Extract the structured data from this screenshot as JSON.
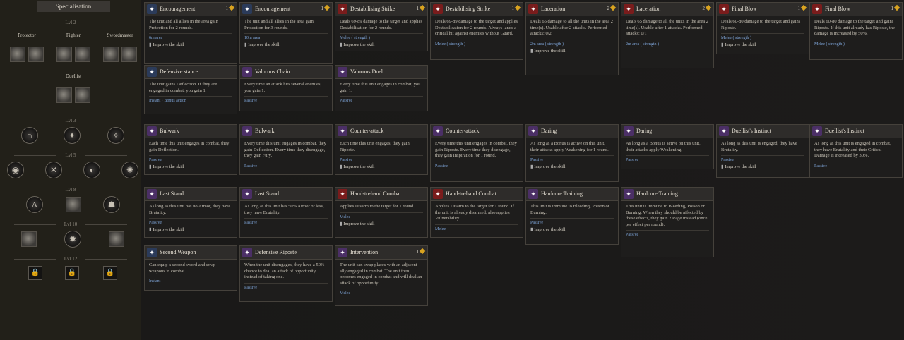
{
  "sidebar": {
    "title": "Specialisation",
    "classes": [
      "Protector",
      "Fighter",
      "Swordmaster",
      "Duellist"
    ],
    "levels": [
      "Lvl 2",
      "Lvl 3",
      "Lvl 5",
      "Lvl 8",
      "Lvl 10",
      "Lvl 12"
    ]
  },
  "cards": [
    {
      "t": "Encouragement",
      "c": "1",
      "d": "The unit and all allies in the area gain Protection for 2 rounds.",
      "f": "6m area",
      "i": "Improve the skill",
      "ic": "b"
    },
    {
      "t": "Encouragement",
      "c": "1",
      "d": "The unit and all allies in the area gain Protection for 3 rounds.",
      "f": "10m area",
      "i": "Improve the skill",
      "ic": "b"
    },
    {
      "t": "Destabilising Strike",
      "c": "1",
      "d": "Deals 69-89 damage to the target and applies Destabilisation for 2 rounds.",
      "f": "Melee ( strength )",
      "i": "Improve the skill",
      "ic": "r"
    },
    {
      "t": "Destabilising Strike",
      "c": "1",
      "d": "Deals 69-89 damage to the target and applies Destabilisation for 2 rounds. Always lands a critical hit against enemies without Guard.",
      "f": "Melee ( strength )",
      "i": "",
      "ic": "r"
    },
    {
      "t": "Laceration",
      "c": "2",
      "d": "Deals 65 damage to all the units in the area 2 time(s). Usable after 2 attacks. Performed attacks: 0/2",
      "f": "2m area ( strength )",
      "i": "Improve the skill",
      "ic": "r"
    },
    {
      "t": "Laceration",
      "c": "2",
      "d": "Deals 65 damage to all the units in the area 2 time(s). Usable after 1 attacks. Performed attacks: 0/1",
      "f": "2m area ( strength )",
      "i": "",
      "ic": "r"
    },
    {
      "t": "Final Blow",
      "c": "1",
      "d": "Deals 60-80 damage to the target and gains Riposte.",
      "f": "Melee ( strength )",
      "i": "Improve the skill",
      "ic": "r"
    },
    {
      "t": "Final Blow",
      "c": "1",
      "d": "Deals 60-80 damage to the target and gains Riposte. If this unit already has Riposte, the damage is increased by 50%.",
      "f": "Melee ( strength )",
      "i": "",
      "ic": "r"
    },
    {
      "t": "Defensive stance",
      "c": "",
      "d": "The unit gains Deflection. If they are engaged in combat, you gain 1.",
      "f": "Instant · Bonus action",
      "i": "",
      "ic": "b"
    },
    {
      "t": "Valorous Chain",
      "c": "",
      "d": "Every time an attack hits several enemies, you gain 1.",
      "f": "Passive",
      "i": "",
      "ic": "p"
    },
    {
      "t": "Valorous Duel",
      "c": "",
      "d": "Every time this unit engages in combat, you gain 1.",
      "f": "Passive",
      "i": "",
      "ic": "p"
    },
    {
      "t": "Bulwark",
      "c": "",
      "d": "Each time this unit engages in combat, they gain Deflection.",
      "f": "Passive",
      "i": "Improve the skill",
      "ic": "p"
    },
    {
      "t": "Bulwark",
      "c": "",
      "d": "Every time this unit engages in combat, they gain Deflection. Every time they disengage, they gain Fury.",
      "f": "Passive",
      "i": "",
      "ic": "p"
    },
    {
      "t": "Counter-attack",
      "c": "",
      "d": "Each time this unit engages, they gain Riposte.",
      "f": "Passive",
      "i": "Improve the skill",
      "ic": "p"
    },
    {
      "t": "Counter-attack",
      "c": "",
      "d": "Every time this unit engages in combat, they gain Riposte. Every time they disengage, they gain Inspiration for 1 round.",
      "f": "Passive",
      "i": "",
      "ic": "p"
    },
    {
      "t": "Daring",
      "c": "",
      "d": "As long as a Bonus is active on this unit, their attacks apply Weakening for 1 round.",
      "f": "Passive",
      "i": "Improve the skill",
      "ic": "p"
    },
    {
      "t": "Daring",
      "c": "",
      "d": "As long as a Bonus is active on this unit, their attacks apply Weakening.",
      "f": "Passive",
      "i": "",
      "ic": "p"
    },
    {
      "t": "Duellist's Instinct",
      "c": "",
      "d": "As long as this unit is engaged, they have Brutality.",
      "f": "Passive",
      "i": "Improve the skill",
      "ic": "p"
    },
    {
      "t": "Duellist's Instinct",
      "c": "",
      "d": "As long as this unit is engaged in combat, they have Brutality and their Critical Damage is increased by 30%.",
      "f": "Passive",
      "i": "",
      "ic": "p"
    },
    {
      "t": "Last Stand",
      "c": "",
      "d": "As long as this unit has no Armor, they have Brutality.",
      "f": "Passive",
      "i": "Improve the skill",
      "ic": "p"
    },
    {
      "t": "Last Stand",
      "c": "",
      "d": "As long as this unit has 50% Armor or less, they have Brutality.",
      "f": "Passive",
      "i": "",
      "ic": "p"
    },
    {
      "t": "Hand-to-hand Combat",
      "c": "",
      "d": "Applies Disarm to the target for 1 round.",
      "f": "Melee",
      "i": "Improve the skill",
      "ic": "r"
    },
    {
      "t": "Hand-to-hand Combat",
      "c": "",
      "d": "Applies Disarm to the target for 1 round. If the unit is already disarmed, also applies Vulnerability.",
      "f": "Melee",
      "i": "",
      "ic": "r"
    },
    {
      "t": "Hardcore Training",
      "c": "",
      "d": "This unit is immune to Bleeding, Poison or Burning.",
      "f": "Passive",
      "i": "Improve the skill",
      "ic": "p"
    },
    {
      "t": "Hardcore Training",
      "c": "",
      "d": "This unit is immune to Bleeding, Poison or Burning. When they should be affected by these effects, they gain 2 Rage instead (once per effect per round).",
      "f": "Passive",
      "i": "",
      "ic": "p"
    },
    {
      "t": "Second Weapon",
      "c": "",
      "d": "Can equip a second sword and swap weapons in combat.",
      "f": "Instant",
      "i": "",
      "ic": "b"
    },
    {
      "t": "Defensive Riposte",
      "c": "",
      "d": "When the unit disengages, they have a 50% chance to deal an attack of opportunity instead of taking one.",
      "f": "Passive",
      "i": "",
      "ic": "p"
    },
    {
      "t": "Intervention",
      "c": "1",
      "d": "The unit can swap places with an adjacent ally engaged in combat. The unit then becomes engaged in combat and will deal an attack of opportunity.",
      "f": "Melee",
      "i": "",
      "ic": "p"
    }
  ]
}
